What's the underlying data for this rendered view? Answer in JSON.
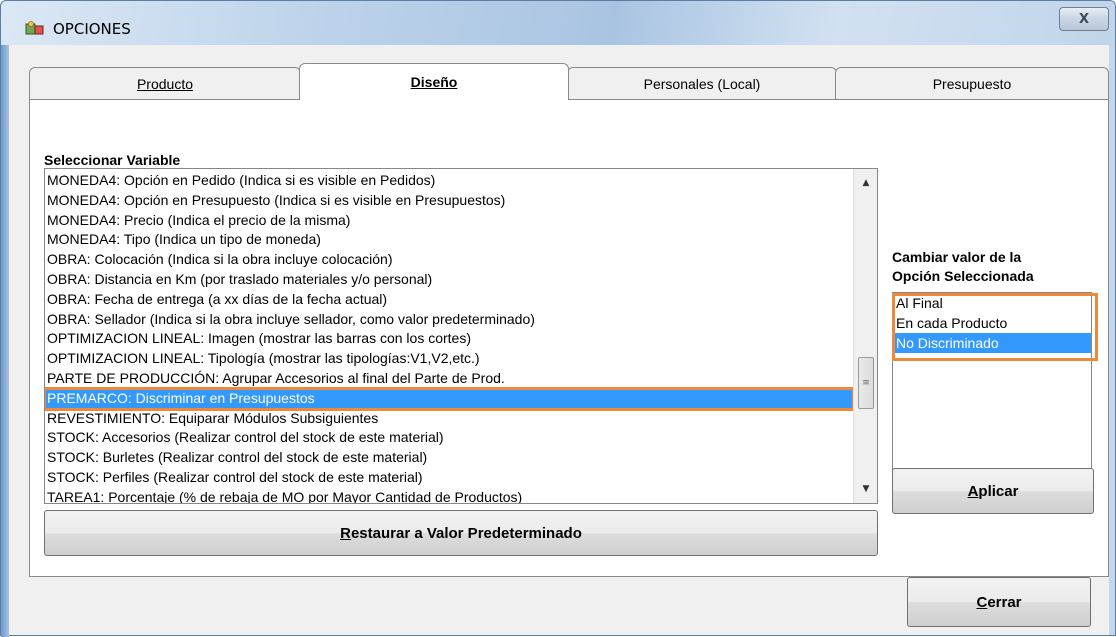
{
  "window": {
    "title": "OPCIONES",
    "close_symbol": "X"
  },
  "tabs": [
    {
      "label": "Producto",
      "active": false
    },
    {
      "label": "Diseño",
      "active": true
    },
    {
      "label": "Personales (Local)",
      "active": false
    },
    {
      "label": "Presupuesto",
      "active": false
    }
  ],
  "variables": {
    "heading": "Seleccionar Variable",
    "items": [
      "MONEDA4: Opción en Pedido (Indica si es visible en Pedidos)",
      "MONEDA4: Opción en Presupuesto (Indica si es visible en Presupuestos)",
      "MONEDA4: Precio (Indica el precio de la misma)",
      "MONEDA4: Tipo (Indica un tipo de moneda)",
      "OBRA: Colocación (Indica si la obra incluye colocación)",
      "OBRA: Distancia en Km (por traslado materiales y/o personal)",
      "OBRA: Fecha de entrega (a xx días de la fecha actual)",
      "OBRA: Sellador (Indica si la obra incluye sellador, como valor predeterminado)",
      "OPTIMIZACION LINEAL: Imagen (mostrar las barras con los cortes)",
      "OPTIMIZACION LINEAL: Tipología (mostrar las tipologías:V1,V2,etc.)",
      "PARTE DE PRODUCCIÓN: Agrupar Accesorios al final del Parte de Prod.",
      "PREMARCO: Discriminar en Presupuestos",
      "REVESTIMIENTO: Equiparar Módulos Subsiguientes",
      "STOCK: Accesorios (Realizar control del stock de este material)",
      "STOCK: Burletes (Realizar control del stock de este material)",
      "STOCK: Perfiles (Realizar control del stock de este material)",
      "TAREA1: Porcentaje (% de rebaja de MO por Mayor Cantidad de Productos)"
    ],
    "selected_index": 11
  },
  "restore_button": {
    "underlined": "R",
    "rest": "estaurar a Valor Predeterminado"
  },
  "value_panel": {
    "heading_line1": "Cambiar valor de la",
    "heading_line2": "Opción Seleccionada",
    "options": [
      "Al Final",
      "En cada Producto",
      "No Discriminado"
    ],
    "selected_index": 2
  },
  "apply_button": {
    "underlined": "A",
    "rest": "plicar"
  },
  "close_button": {
    "underlined": "C",
    "rest": "errar"
  },
  "colors": {
    "selection": "#3399ff",
    "highlight_outline": "#f0883a"
  }
}
